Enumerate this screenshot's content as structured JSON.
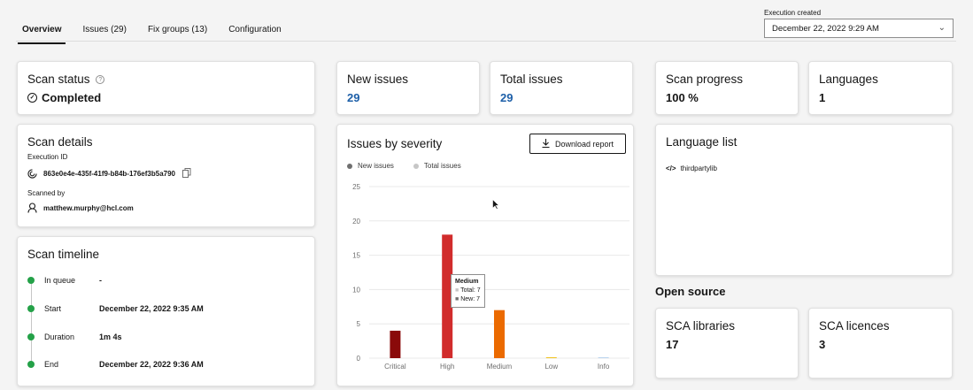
{
  "tabs": [
    {
      "label": "Overview",
      "active": true
    },
    {
      "label": "Issues (29)",
      "active": false
    },
    {
      "label": "Fix groups (13)",
      "active": false
    },
    {
      "label": "Configuration",
      "active": false
    }
  ],
  "execution": {
    "label": "Execution created",
    "selected": "December 22, 2022 9:29 AM"
  },
  "scan_status": {
    "title": "Scan status",
    "value": "Completed"
  },
  "new_issues": {
    "title": "New issues",
    "value": "29"
  },
  "total_issues": {
    "title": "Total issues",
    "value": "29"
  },
  "scan_progress": {
    "title": "Scan progress",
    "value": "100 %"
  },
  "languages": {
    "title": "Languages",
    "value": "1"
  },
  "scan_details": {
    "title": "Scan details",
    "execution_id_label": "Execution ID",
    "execution_id": "863e0e4e-435f-41f9-b84b-176ef3b5a790",
    "scanned_by_label": "Scanned by",
    "scanned_by": "matthew.murphy@hcl.com"
  },
  "severity_card": {
    "title": "Issues by severity",
    "download_label": "Download report"
  },
  "language_list": {
    "title": "Language list",
    "items": [
      "thirdpartylib"
    ]
  },
  "scan_timeline": {
    "title": "Scan timeline",
    "rows": [
      {
        "label": "In queue",
        "value": "-"
      },
      {
        "label": "Start",
        "value": "December 22, 2022 9:35 AM"
      },
      {
        "label": "Duration",
        "value": "1m 4s"
      },
      {
        "label": "End",
        "value": "December 22, 2022 9:36 AM"
      }
    ]
  },
  "open_source": {
    "heading": "Open source",
    "sca_libraries": {
      "title": "SCA libraries",
      "value": "17"
    },
    "sca_licences": {
      "title": "SCA licences",
      "value": "3"
    }
  },
  "tooltip": {
    "title": "Medium",
    "total_line": "Total: 7",
    "new_line": "New: 7"
  },
  "colors": {
    "completed": "#161616",
    "timeline_dot": "#24a148",
    "link_blue": "#1d5fa8",
    "new_legend": "#6f6f6f",
    "total_legend": "#c6c6c6"
  },
  "chart_data": {
    "type": "bar",
    "categories": [
      "Critical",
      "High",
      "Medium",
      "Low",
      "Info"
    ],
    "series": [
      {
        "name": "New issues",
        "values": [
          4,
          18,
          7,
          0,
          0
        ]
      },
      {
        "name": "Total issues",
        "values": [
          4,
          18,
          7,
          0,
          0
        ]
      }
    ],
    "bar_colors": [
      "#8a0a0a",
      "#d12c2c",
      "#eb6a00",
      "#f1c21b",
      "#b9d3ee"
    ],
    "yticks": [
      0,
      5,
      10,
      15,
      20,
      25
    ],
    "ylim": [
      0,
      25
    ],
    "legend": "top-left",
    "grid": true
  }
}
